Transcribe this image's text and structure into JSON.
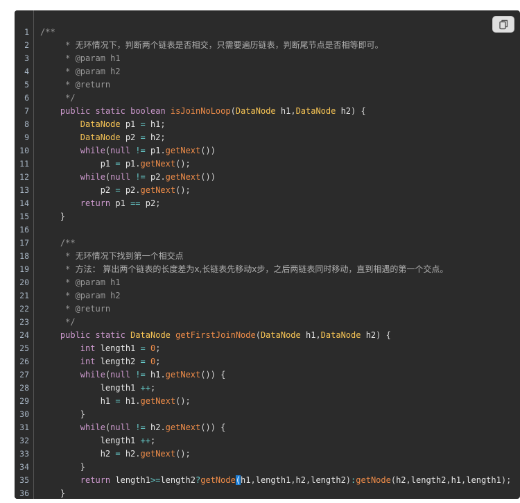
{
  "code_block": {
    "language": "java",
    "copy_icon": "copy-icon",
    "lines": [
      {
        "n": "1",
        "t": [
          [
            "cm",
            "/**"
          ]
        ]
      },
      {
        "n": "2",
        "t": [
          [
            "cm",
            "     * "
          ],
          [
            "cmc",
            "无环情况下，判断两个链表是否相交，只需要遍历链表，判断尾节点是否相等即可。"
          ]
        ]
      },
      {
        "n": "3",
        "t": [
          [
            "cm",
            "     * @param h1"
          ]
        ]
      },
      {
        "n": "4",
        "t": [
          [
            "cm",
            "     * @param h2"
          ]
        ]
      },
      {
        "n": "5",
        "t": [
          [
            "cm",
            "     * @return"
          ]
        ]
      },
      {
        "n": "6",
        "t": [
          [
            "cm",
            "     */"
          ]
        ]
      },
      {
        "n": "7",
        "t": [
          [
            "tx",
            "    "
          ],
          [
            "kw",
            "public"
          ],
          [
            "tx",
            " "
          ],
          [
            "kw",
            "static"
          ],
          [
            "tx",
            " "
          ],
          [
            "kw",
            "boolean"
          ],
          [
            "tx",
            " "
          ],
          [
            "fn",
            "isJoinNoLoop"
          ],
          [
            "pn",
            "("
          ],
          [
            "type",
            "DataNode"
          ],
          [
            "tx",
            " h1"
          ],
          [
            "pn",
            ","
          ],
          [
            "type",
            "DataNode"
          ],
          [
            "tx",
            " h2"
          ],
          [
            "pn",
            ")"
          ],
          [
            "tx",
            " "
          ],
          [
            "pn",
            "{"
          ]
        ]
      },
      {
        "n": "8",
        "t": [
          [
            "tx",
            "        "
          ],
          [
            "type",
            "DataNode"
          ],
          [
            "tx",
            " p1 "
          ],
          [
            "op",
            "="
          ],
          [
            "tx",
            " h1"
          ],
          [
            "pn",
            ";"
          ]
        ]
      },
      {
        "n": "9",
        "t": [
          [
            "tx",
            "        "
          ],
          [
            "type",
            "DataNode"
          ],
          [
            "tx",
            " p2 "
          ],
          [
            "op",
            "="
          ],
          [
            "tx",
            " h2"
          ],
          [
            "pn",
            ";"
          ]
        ]
      },
      {
        "n": "10",
        "t": [
          [
            "tx",
            "        "
          ],
          [
            "kw",
            "while"
          ],
          [
            "pn",
            "("
          ],
          [
            "kw",
            "null"
          ],
          [
            "tx",
            " "
          ],
          [
            "op",
            "!="
          ],
          [
            "tx",
            " p1"
          ],
          [
            "pn",
            "."
          ],
          [
            "fn",
            "getNext"
          ],
          [
            "pn",
            "())"
          ]
        ]
      },
      {
        "n": "11",
        "t": [
          [
            "tx",
            "            p1 "
          ],
          [
            "op",
            "="
          ],
          [
            "tx",
            " p1"
          ],
          [
            "pn",
            "."
          ],
          [
            "fn",
            "getNext"
          ],
          [
            "pn",
            "();"
          ]
        ]
      },
      {
        "n": "12",
        "t": [
          [
            "tx",
            "        "
          ],
          [
            "kw",
            "while"
          ],
          [
            "pn",
            "("
          ],
          [
            "kw",
            "null"
          ],
          [
            "tx",
            " "
          ],
          [
            "op",
            "!="
          ],
          [
            "tx",
            " p2"
          ],
          [
            "pn",
            "."
          ],
          [
            "fn",
            "getNext"
          ],
          [
            "pn",
            "())"
          ]
        ]
      },
      {
        "n": "13",
        "t": [
          [
            "tx",
            "            p2 "
          ],
          [
            "op",
            "="
          ],
          [
            "tx",
            " p2"
          ],
          [
            "pn",
            "."
          ],
          [
            "fn",
            "getNext"
          ],
          [
            "pn",
            "();"
          ]
        ]
      },
      {
        "n": "14",
        "t": [
          [
            "tx",
            "        "
          ],
          [
            "kw",
            "return"
          ],
          [
            "tx",
            " p1 "
          ],
          [
            "op",
            "=="
          ],
          [
            "tx",
            " p2"
          ],
          [
            "pn",
            ";"
          ]
        ]
      },
      {
        "n": "15",
        "t": [
          [
            "tx",
            "    "
          ],
          [
            "pn",
            "}"
          ]
        ]
      },
      {
        "n": "16",
        "t": []
      },
      {
        "n": "17",
        "t": [
          [
            "cm",
            "    /**"
          ]
        ]
      },
      {
        "n": "18",
        "t": [
          [
            "cm",
            "     * "
          ],
          [
            "cmc",
            "无环情况下找到第一个相交点"
          ]
        ]
      },
      {
        "n": "19",
        "t": [
          [
            "cm",
            "     * "
          ],
          [
            "cmc",
            "方法： 算出两个链表的长度差为x,长链表先移动x步，之后两链表同时移动，直到相遇的第一个交点。"
          ]
        ]
      },
      {
        "n": "20",
        "t": [
          [
            "cm",
            "     * @param h1"
          ]
        ]
      },
      {
        "n": "21",
        "t": [
          [
            "cm",
            "     * @param h2"
          ]
        ]
      },
      {
        "n": "22",
        "t": [
          [
            "cm",
            "     * @return"
          ]
        ]
      },
      {
        "n": "23",
        "t": [
          [
            "cm",
            "     */"
          ]
        ]
      },
      {
        "n": "24",
        "t": [
          [
            "tx",
            "    "
          ],
          [
            "kw",
            "public"
          ],
          [
            "tx",
            " "
          ],
          [
            "kw",
            "static"
          ],
          [
            "tx",
            " "
          ],
          [
            "type",
            "DataNode"
          ],
          [
            "tx",
            " "
          ],
          [
            "fn",
            "getFirstJoinNode"
          ],
          [
            "pn",
            "("
          ],
          [
            "type",
            "DataNode"
          ],
          [
            "tx",
            " h1"
          ],
          [
            "pn",
            ","
          ],
          [
            "type",
            "DataNode"
          ],
          [
            "tx",
            " h2"
          ],
          [
            "pn",
            ")"
          ],
          [
            "tx",
            " "
          ],
          [
            "pn",
            "{"
          ]
        ]
      },
      {
        "n": "25",
        "t": [
          [
            "tx",
            "        "
          ],
          [
            "kw",
            "int"
          ],
          [
            "tx",
            " length1 "
          ],
          [
            "op",
            "="
          ],
          [
            "tx",
            " "
          ],
          [
            "num",
            "0"
          ],
          [
            "pn",
            ";"
          ]
        ]
      },
      {
        "n": "26",
        "t": [
          [
            "tx",
            "        "
          ],
          [
            "kw",
            "int"
          ],
          [
            "tx",
            " length2 "
          ],
          [
            "op",
            "="
          ],
          [
            "tx",
            " "
          ],
          [
            "num",
            "0"
          ],
          [
            "pn",
            ";"
          ]
        ]
      },
      {
        "n": "27",
        "t": [
          [
            "tx",
            "        "
          ],
          [
            "kw",
            "while"
          ],
          [
            "pn",
            "("
          ],
          [
            "kw",
            "null"
          ],
          [
            "tx",
            " "
          ],
          [
            "op",
            "!="
          ],
          [
            "tx",
            " h1"
          ],
          [
            "pn",
            "."
          ],
          [
            "fn",
            "getNext"
          ],
          [
            "pn",
            "())"
          ],
          [
            "tx",
            " "
          ],
          [
            "pn",
            "{"
          ]
        ]
      },
      {
        "n": "28",
        "t": [
          [
            "tx",
            "            length1 "
          ],
          [
            "op",
            "++"
          ],
          [
            "pn",
            ";"
          ]
        ]
      },
      {
        "n": "29",
        "t": [
          [
            "tx",
            "            h1 "
          ],
          [
            "op",
            "="
          ],
          [
            "tx",
            " h1"
          ],
          [
            "pn",
            "."
          ],
          [
            "fn",
            "getNext"
          ],
          [
            "pn",
            "();"
          ]
        ]
      },
      {
        "n": "30",
        "t": [
          [
            "tx",
            "        "
          ],
          [
            "pn",
            "}"
          ]
        ]
      },
      {
        "n": "31",
        "t": [
          [
            "tx",
            "        "
          ],
          [
            "kw",
            "while"
          ],
          [
            "pn",
            "("
          ],
          [
            "kw",
            "null"
          ],
          [
            "tx",
            " "
          ],
          [
            "op",
            "!="
          ],
          [
            "tx",
            " h2"
          ],
          [
            "pn",
            "."
          ],
          [
            "fn",
            "getNext"
          ],
          [
            "pn",
            "())"
          ],
          [
            "tx",
            " "
          ],
          [
            "pn",
            "{"
          ]
        ]
      },
      {
        "n": "32",
        "t": [
          [
            "tx",
            "            length1 "
          ],
          [
            "op",
            "++"
          ],
          [
            "pn",
            ";"
          ]
        ]
      },
      {
        "n": "33",
        "t": [
          [
            "tx",
            "            h2 "
          ],
          [
            "op",
            "="
          ],
          [
            "tx",
            " h2"
          ],
          [
            "pn",
            "."
          ],
          [
            "fn",
            "getNext"
          ],
          [
            "pn",
            "();"
          ]
        ]
      },
      {
        "n": "34",
        "t": [
          [
            "tx",
            "        "
          ],
          [
            "pn",
            "}"
          ]
        ]
      },
      {
        "n": "35",
        "t": [
          [
            "tx",
            "        "
          ],
          [
            "kw",
            "return"
          ],
          [
            "tx",
            " length1"
          ],
          [
            "op",
            ">="
          ],
          [
            "tx",
            "length2"
          ],
          [
            "op",
            "?"
          ],
          [
            "fn",
            "getNode"
          ],
          [
            "cur",
            "("
          ],
          [
            "tx",
            "h1"
          ],
          [
            "pn",
            ","
          ],
          [
            "tx",
            "length1"
          ],
          [
            "pn",
            ","
          ],
          [
            "tx",
            "h2"
          ],
          [
            "pn",
            ","
          ],
          [
            "tx",
            "length2"
          ],
          [
            "pn",
            ")"
          ],
          [
            "op",
            ":"
          ],
          [
            "fn",
            "getNode"
          ],
          [
            "pn",
            "("
          ],
          [
            "tx",
            "h2"
          ],
          [
            "pn",
            ","
          ],
          [
            "tx",
            "length2"
          ],
          [
            "pn",
            ","
          ],
          [
            "tx",
            "h1"
          ],
          [
            "pn",
            ","
          ],
          [
            "tx",
            "length1"
          ],
          [
            "pn",
            ");"
          ]
        ]
      },
      {
        "n": "36",
        "t": [
          [
            "tx",
            "    "
          ],
          [
            "pn",
            "}"
          ]
        ]
      }
    ]
  }
}
